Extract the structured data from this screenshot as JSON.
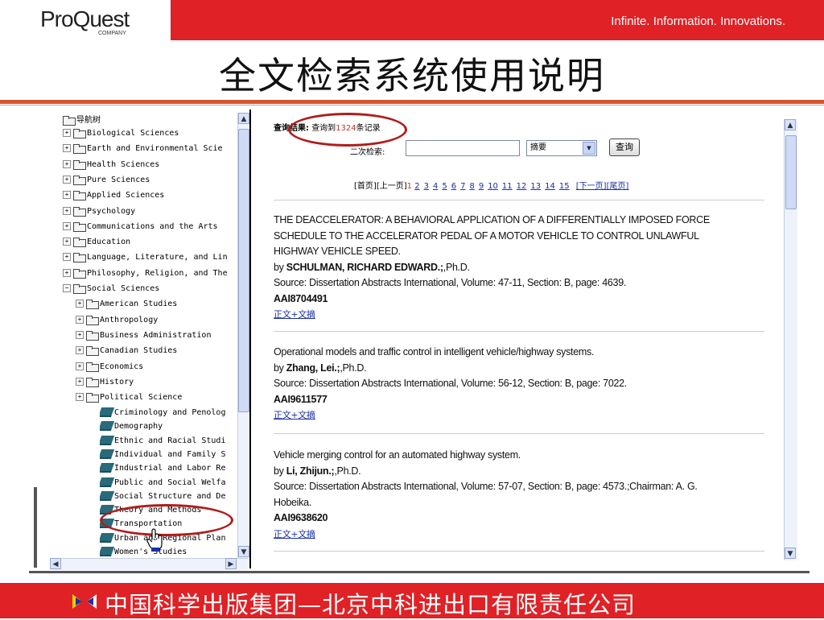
{
  "header": {
    "logo": "ProQuest",
    "logo_sub": "COMPANY",
    "tagline": "Infinite. Information. Innovations.",
    "title": "全文检索系统使用说明",
    "colors": {
      "brand_red": "#e02126",
      "rule_orange": "#d9562b"
    }
  },
  "tree": {
    "root_label": "导航树",
    "items": [
      {
        "label": "Biological Sciences",
        "expander": "+"
      },
      {
        "label": "Earth and Environmental Scie",
        "expander": "+"
      },
      {
        "label": "Health Sciences",
        "expander": "+"
      },
      {
        "label": "Pure Sciences",
        "expander": "+"
      },
      {
        "label": "Applied Sciences",
        "expander": "+"
      },
      {
        "label": "Psychology",
        "expander": "+"
      },
      {
        "label": "Communications and the Arts",
        "expander": "+"
      },
      {
        "label": "Education",
        "expander": "+"
      },
      {
        "label": "Language, Literature, and Lin",
        "expander": "+"
      },
      {
        "label": "Philosophy, Religion, and The",
        "expander": "+"
      },
      {
        "label": "Social Sciences",
        "expander": "−"
      }
    ],
    "social_children": [
      {
        "label": "American Studies",
        "expander": "+"
      },
      {
        "label": "Anthropology",
        "expander": "+"
      },
      {
        "label": "Business Administration",
        "expander": "+"
      },
      {
        "label": "Canadian Studies",
        "expander": "+"
      },
      {
        "label": "Economics",
        "expander": "+"
      },
      {
        "label": "History",
        "expander": "+"
      },
      {
        "label": "Political Science",
        "expander": "+"
      }
    ],
    "leaves": [
      {
        "label": "Criminology and Penolog"
      },
      {
        "label": "Demography"
      },
      {
        "label": "Ethnic and Racial Studi"
      },
      {
        "label": "Individual and Family S"
      },
      {
        "label": "Industrial and Labor Re"
      },
      {
        "label": "Public and Social Welfa"
      },
      {
        "label": "Social Structure and De"
      },
      {
        "label": "Theory and Methods"
      },
      {
        "label": "Transportation"
      },
      {
        "label": "Urban and Regional Plan"
      },
      {
        "label": "Women's Studies"
      }
    ]
  },
  "results": {
    "prefix": "查询结果:",
    "count_prefix": "查询到",
    "count": "1324",
    "count_suffix": "条记录",
    "secondary_label": "二次检索:",
    "secondary_value": "",
    "field_value": "摘要",
    "field_options": [
      "摘要"
    ],
    "search_button": "查询",
    "pager": {
      "first": "[首页]",
      "prev": "[上一页]",
      "current": "1",
      "pages": [
        "2",
        "3",
        "4",
        "5",
        "6",
        "7",
        "8",
        "9",
        "10",
        "11",
        "12",
        "13",
        "14",
        "15"
      ],
      "next": "[下一页]",
      "last": "[尾页]"
    },
    "records": [
      {
        "title": "THE DEACCELERATOR: A BEHAVIORAL APPLICATION OF A DIFFERENTIALLY IMPOSED FORCE SCHEDULE TO THE ACCELERATOR PEDAL OF A MOTOR VEHICLE TO CONTROL UNLAWFUL HIGHWAY VEHICLE SPEED.",
        "by": "by",
        "author": "SCHULMAN, RICHARD EDWARD.;",
        "degree": ",Ph.D.",
        "source": "Source: Dissertation Abstracts International, Volume: 47-11, Section: B, page: 4639.",
        "aid": "AAI8704491",
        "fulltext": "正文+文摘"
      },
      {
        "title": "Operational models and traffic control in intelligent vehicle/highway systems.",
        "by": "by",
        "author": "Zhang, Lei.;",
        "degree": ",Ph.D.",
        "source": "Source: Dissertation Abstracts International, Volume: 56-12, Section: B, page: 7022.",
        "aid": "AAI9611577",
        "fulltext": "正文+文摘"
      },
      {
        "title": "Vehicle merging control for an automated highway system.",
        "by": "by",
        "author": "Li, Zhijun.;",
        "degree": ",Ph.D.",
        "source": "Source: Dissertation Abstracts International, Volume: 57-07, Section: B, page: 4573.;Chairman: A. G. Hobeika.",
        "aid": "AAI9638620",
        "fulltext": "正文+文摘"
      }
    ]
  },
  "footer": {
    "text": "中国科学出版集团—北京中科进出口有限责任公司"
  },
  "icons": [
    "folder-icon",
    "book-icon",
    "scroll-up-icon",
    "scroll-down-icon",
    "hand-cursor-icon",
    "dropdown-arrow-icon"
  ]
}
